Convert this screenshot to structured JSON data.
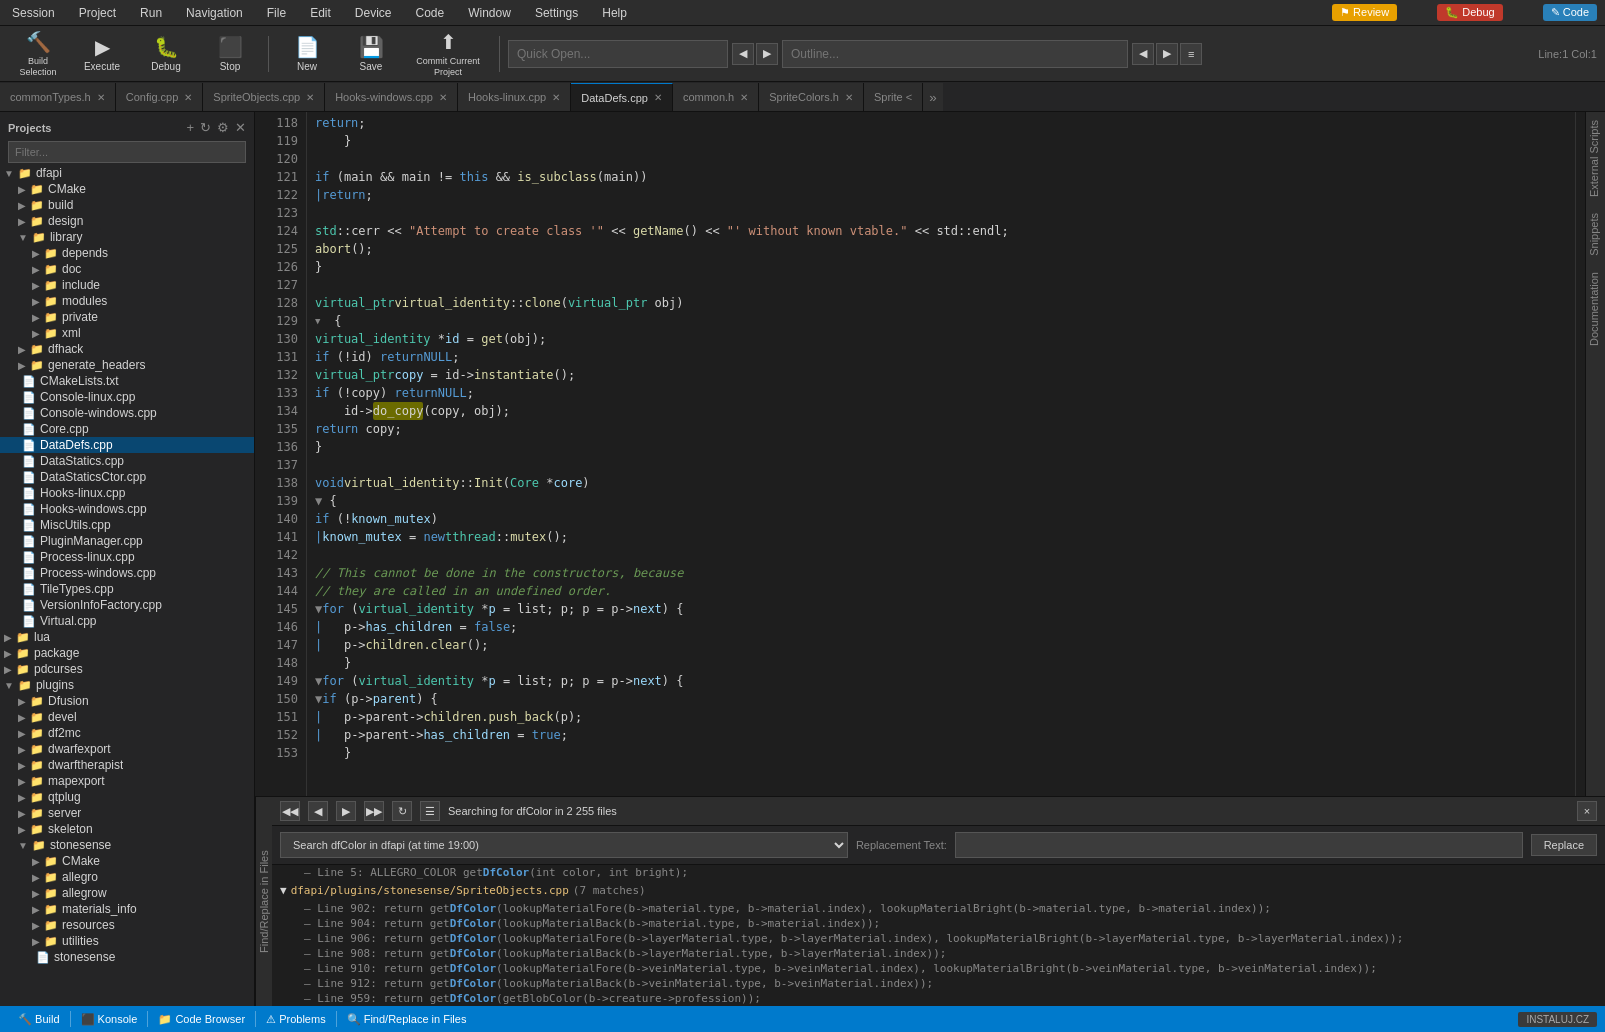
{
  "menubar": {
    "items": [
      "Session",
      "Project",
      "Run",
      "Navigation",
      "File",
      "Edit",
      "Device",
      "Code",
      "Window",
      "Settings",
      "Help"
    ]
  },
  "toolbar": {
    "build_label": "Build Selection",
    "execute_label": "Execute",
    "debug_label": "Debug",
    "stop_label": "Stop",
    "new_label": "New",
    "save_label": "Save",
    "commit_label": "Commit Current Project",
    "search_placeholder": "Quick Open...",
    "outline_placeholder": "Outline...",
    "line_info": "Line:1 Col:1"
  },
  "tabs": [
    {
      "label": "commonTypes.h",
      "active": false,
      "closable": true
    },
    {
      "label": "Config.cpp",
      "active": false,
      "closable": true
    },
    {
      "label": "SpriteObjects.cpp",
      "active": false,
      "closable": true
    },
    {
      "label": "Hooks-windows.cpp",
      "active": false,
      "closable": true
    },
    {
      "label": "Hooks-linux.cpp",
      "active": false,
      "closable": true
    },
    {
      "label": "DataDefs.cpp",
      "active": true,
      "closable": true
    },
    {
      "label": "common.h",
      "active": false,
      "closable": true
    },
    {
      "label": "SpriteColors.h",
      "active": false,
      "closable": true
    },
    {
      "label": "Sprite <",
      "active": false,
      "closable": false
    }
  ],
  "sidebar": {
    "title": "Projects",
    "filter_placeholder": "Filter...",
    "tree": [
      {
        "level": 0,
        "icon": "▼",
        "label": "dfapi",
        "type": "folder"
      },
      {
        "level": 1,
        "icon": "▶",
        "label": "CMake",
        "type": "folder"
      },
      {
        "level": 1,
        "icon": "▶",
        "label": "build",
        "type": "folder"
      },
      {
        "level": 1,
        "icon": "▶",
        "label": "design",
        "type": "folder"
      },
      {
        "level": 1,
        "icon": "▼",
        "label": "library",
        "type": "folder"
      },
      {
        "level": 2,
        "icon": "▶",
        "label": "depends",
        "type": "folder"
      },
      {
        "level": 2,
        "icon": "▶",
        "label": "doc",
        "type": "folder"
      },
      {
        "level": 2,
        "icon": "▶",
        "label": "include",
        "type": "folder"
      },
      {
        "level": 2,
        "icon": "▶",
        "label": "modules",
        "type": "folder"
      },
      {
        "level": 2,
        "icon": "▶",
        "label": "private",
        "type": "folder"
      },
      {
        "level": 2,
        "icon": "▶",
        "label": "xml",
        "type": "folder"
      },
      {
        "level": 1,
        "icon": "▶",
        "label": "dfhack",
        "type": "folder"
      },
      {
        "level": 1,
        "icon": "▶",
        "label": "generate_headers",
        "type": "folder"
      },
      {
        "level": 1,
        "icon": "",
        "label": "CMakeLists.txt",
        "type": "file"
      },
      {
        "level": 1,
        "icon": "",
        "label": "Console-linux.cpp",
        "type": "file"
      },
      {
        "level": 1,
        "icon": "",
        "label": "Console-windows.cpp",
        "type": "file"
      },
      {
        "level": 1,
        "icon": "",
        "label": "Core.cpp",
        "type": "file"
      },
      {
        "level": 1,
        "icon": "",
        "label": "DataDefs.cpp",
        "type": "file",
        "active": true
      },
      {
        "level": 1,
        "icon": "",
        "label": "DataStatics.cpp",
        "type": "file"
      },
      {
        "level": 1,
        "icon": "",
        "label": "DataStaticsCtor.cpp",
        "type": "file"
      },
      {
        "level": 1,
        "icon": "",
        "label": "Hooks-linux.cpp",
        "type": "file"
      },
      {
        "level": 1,
        "icon": "",
        "label": "Hooks-windows.cpp",
        "type": "file"
      },
      {
        "level": 1,
        "icon": "",
        "label": "MiscUtils.cpp",
        "type": "file"
      },
      {
        "level": 1,
        "icon": "",
        "label": "PluginManager.cpp",
        "type": "file"
      },
      {
        "level": 1,
        "icon": "",
        "label": "Process-linux.cpp",
        "type": "file"
      },
      {
        "level": 1,
        "icon": "",
        "label": "Process-windows.cpp",
        "type": "file"
      },
      {
        "level": 1,
        "icon": "",
        "label": "TileTypes.cpp",
        "type": "file"
      },
      {
        "level": 1,
        "icon": "",
        "label": "VersionInfoFactory.cpp",
        "type": "file"
      },
      {
        "level": 1,
        "icon": "",
        "label": "Virtual.cpp",
        "type": "file"
      },
      {
        "level": 0,
        "icon": "▶",
        "label": "lua",
        "type": "folder"
      },
      {
        "level": 0,
        "icon": "▶",
        "label": "package",
        "type": "folder"
      },
      {
        "level": 0,
        "icon": "▶",
        "label": "pdcurses",
        "type": "folder"
      },
      {
        "level": 0,
        "icon": "▼",
        "label": "plugins",
        "type": "folder"
      },
      {
        "level": 1,
        "icon": "▶",
        "label": "Dfusion",
        "type": "folder"
      },
      {
        "level": 1,
        "icon": "▶",
        "label": "devel",
        "type": "folder"
      },
      {
        "level": 1,
        "icon": "▶",
        "label": "df2mc",
        "type": "folder"
      },
      {
        "level": 1,
        "icon": "▶",
        "label": "dwarfexport",
        "type": "folder"
      },
      {
        "level": 1,
        "icon": "▶",
        "label": "dwarftherapist",
        "type": "folder"
      },
      {
        "level": 1,
        "icon": "▶",
        "label": "mapexport",
        "type": "folder"
      },
      {
        "level": 1,
        "icon": "▶",
        "label": "qtplug",
        "type": "folder"
      },
      {
        "level": 1,
        "icon": "▶",
        "label": "server",
        "type": "folder"
      },
      {
        "level": 1,
        "icon": "▶",
        "label": "skeleton",
        "type": "folder"
      },
      {
        "level": 1,
        "icon": "▼",
        "label": "stonesense",
        "type": "folder"
      },
      {
        "level": 2,
        "icon": "▶",
        "label": "CMake",
        "type": "folder"
      },
      {
        "level": 2,
        "icon": "▶",
        "label": "allegro",
        "type": "folder"
      },
      {
        "level": 2,
        "icon": "▶",
        "label": "allegrow",
        "type": "folder"
      },
      {
        "level": 2,
        "icon": "▶",
        "label": "materials_info",
        "type": "folder"
      },
      {
        "level": 2,
        "icon": "▶",
        "label": "resources",
        "type": "folder"
      },
      {
        "level": 2,
        "icon": "▶",
        "label": "utilities",
        "type": "folder"
      },
      {
        "level": 2,
        "icon": "",
        "label": "stonesense",
        "type": "file"
      }
    ]
  },
  "editor": {
    "lines": [
      {
        "num": 118,
        "content": "        return;",
        "tokens": [
          {
            "text": "        return;",
            "class": "kw-inline"
          }
        ]
      },
      {
        "num": 119,
        "content": "    }"
      },
      {
        "num": 120,
        "content": ""
      },
      {
        "num": 121,
        "content": "    if (main && main != this && is_subclass(main))"
      },
      {
        "num": 122,
        "content": "    |   return;"
      },
      {
        "num": 123,
        "content": ""
      },
      {
        "num": 124,
        "content": "    std::cerr << \"Attempt to create class '\" << getName() << \"' without known vtable.\" << std::endl;"
      },
      {
        "num": 125,
        "content": "    abort();"
      },
      {
        "num": 126,
        "content": "}"
      },
      {
        "num": 127,
        "content": ""
      },
      {
        "num": 128,
        "content": "virtual_ptr virtual_identity::clone(virtual_ptr obj)"
      },
      {
        "num": 129,
        "content": "▼ {"
      },
      {
        "num": 130,
        "content": "    virtual_identity *id = get(obj);"
      },
      {
        "num": 131,
        "content": "    if (!id) return NULL;"
      },
      {
        "num": 132,
        "content": "    virtual_ptr copy = id->instantiate();"
      },
      {
        "num": 133,
        "content": "    if (!copy) return NULL;"
      },
      {
        "num": 134,
        "content": "    id->do_copy(copy, obj);"
      },
      {
        "num": 135,
        "content": "    return copy;"
      },
      {
        "num": 136,
        "content": "}"
      },
      {
        "num": 137,
        "content": ""
      },
      {
        "num": 138,
        "content": "void virtual_identity::Init(Core *core)"
      },
      {
        "num": 139,
        "content": "▼ {"
      },
      {
        "num": 140,
        "content": "    if (!known_mutex)"
      },
      {
        "num": 141,
        "content": "    |   known_mutex = new tthread::mutex();"
      },
      {
        "num": 142,
        "content": ""
      },
      {
        "num": 143,
        "content": "    // This cannot be done in the constructors, because"
      },
      {
        "num": 144,
        "content": "    // they are called in an undefined order."
      },
      {
        "num": 145,
        "content": "▼  for (virtual_identity *p = list; p; p = p->next) {"
      },
      {
        "num": 146,
        "content": "    |   p->has_children = false;"
      },
      {
        "num": 147,
        "content": "    |   p->children.clear();"
      },
      {
        "num": 148,
        "content": "    }"
      },
      {
        "num": 149,
        "content": "▼  for (virtual_identity *p = list; p; p = p->next) {"
      },
      {
        "num": 150,
        "content": "▼  if (p->parent) {"
      },
      {
        "num": 151,
        "content": "    |   p->parent->children.push_back(p);"
      },
      {
        "num": 152,
        "content": "    |   p->parent->has_children = true;"
      },
      {
        "num": 153,
        "content": "    }"
      }
    ]
  },
  "find_replace": {
    "status": "Searching for dfColor in 2 255 files",
    "search_label": "Search dfColor in dfapi (at time 19:00)",
    "replacement_label": "Replacement Text:",
    "replace_btn": "Replace",
    "close_btn": "×",
    "nav_btns": [
      "◀◀",
      "◀",
      "▶",
      "▶▶",
      "⟳",
      "☰"
    ],
    "group": {
      "path": "dfapi/plugins/stonesense/SpriteObjects.cpp",
      "matches": "7 matches",
      "fold": "▼"
    },
    "results": [
      {
        "line": 5,
        "content": "ALLEGRO_COLOR getDfColor(int color, int bright);"
      },
      {
        "line": 902,
        "content": "return getDfColor(lookupMaterialFore(b->material.type, b->material.index), lookupMaterialBright(b->material.type, b->material.index));"
      },
      {
        "line": 904,
        "content": "return getDfColor(lookupMaterialBack(b->material.type, b->material.index));"
      },
      {
        "line": 906,
        "content": "return getDfColor(lookupMaterialFore(b->layerMaterial.type, b->layerMaterial.index), lookupMaterialBright(b->layerMaterial.type, b->layerMaterial.index));"
      },
      {
        "line": 908,
        "content": "return getDfColor(lookupMaterialBack(b->layerMaterial.type, b->layerMaterial.index));"
      },
      {
        "line": 910,
        "content": "return getDfColor(lookupMaterialFore(b->veinMaterial.type, b->veinMaterial.index), lookupMaterialBright(b->veinMaterial.type, b->veinMaterial.index));"
      },
      {
        "line": 912,
        "content": "return getDfColor(lookupMaterialBack(b->veinMaterial.type, b->veinMaterial.index));"
      },
      {
        "line": 959,
        "content": "return getDfColor(getBlobColor(b->creature->profession));"
      }
    ]
  },
  "statusbar": {
    "items": [
      "Build",
      "Konsole",
      "Code Browser",
      "Problems",
      "Find/Replace in Files"
    ],
    "right_items": [
      "INSTALUJ.CZ"
    ]
  },
  "external_tabs": [
    "Review",
    "Debug",
    "Code"
  ],
  "right_side_tabs": [
    "External Scripts",
    "Snippets",
    "Documentation"
  ]
}
